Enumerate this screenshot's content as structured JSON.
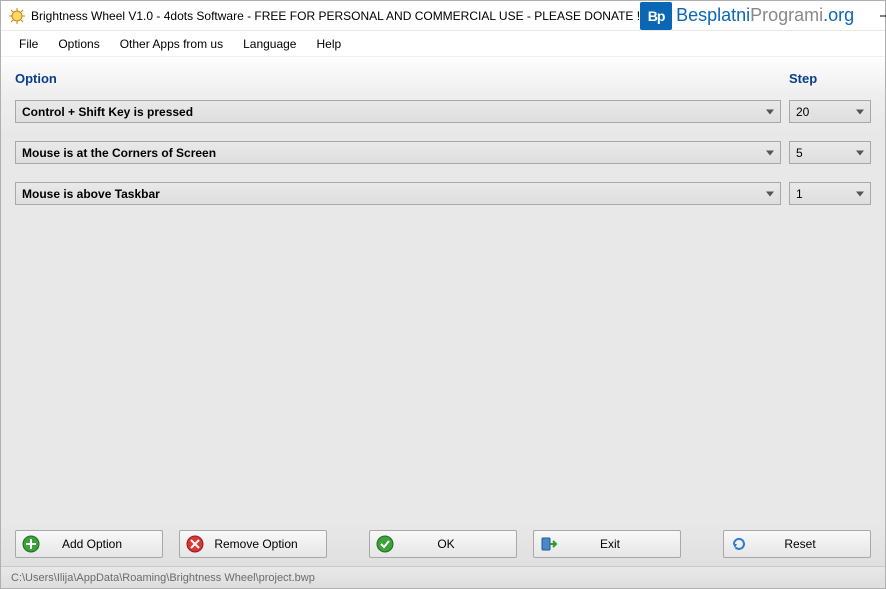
{
  "window": {
    "title": "Brightness Wheel V1.0 - 4dots Software - FREE FOR PERSONAL AND COMMERCIAL USE - PLEASE DONATE !"
  },
  "brand": {
    "logo_text": "Bp",
    "text_main": "Besplatni",
    "text_accent": "Programi",
    "text_tld": ".org"
  },
  "menu": {
    "file": "File",
    "options": "Options",
    "other_apps": "Other Apps from us",
    "language": "Language",
    "help": "Help"
  },
  "headers": {
    "option": "Option",
    "step": "Step"
  },
  "rows": [
    {
      "option": "Control + Shift Key is pressed",
      "step": "20"
    },
    {
      "option": "Mouse is at the Corners of Screen",
      "step": "5"
    },
    {
      "option": "Mouse is above Taskbar",
      "step": "1"
    }
  ],
  "buttons": {
    "add_option": "Add Option",
    "remove_option": "Remove Option",
    "ok": "OK",
    "exit": "Exit",
    "reset": "Reset"
  },
  "status": {
    "path": "C:\\Users\\Ilija\\AppData\\Roaming\\Brightness Wheel\\project.bwp"
  }
}
